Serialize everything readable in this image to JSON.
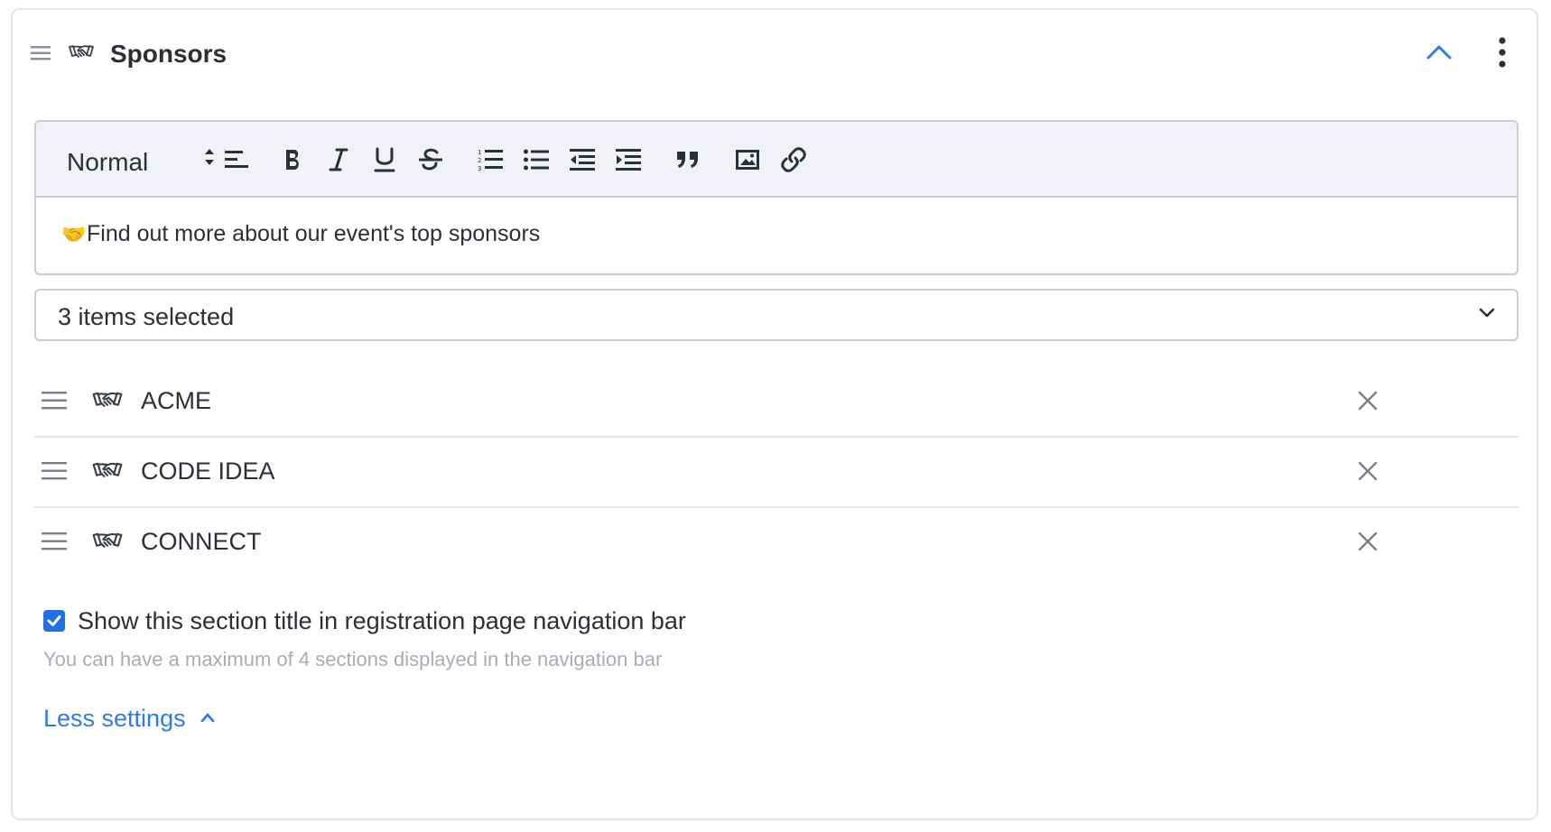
{
  "section": {
    "title": "Sponsors",
    "icon": "handshake-icon",
    "collapse_icon": "chevron-up-icon",
    "more_icon": "more-vertical-icon"
  },
  "editor": {
    "format_select": "Normal",
    "toolbar_icons": [
      "align-left-icon",
      "bold-icon",
      "italic-icon",
      "underline-icon",
      "strikethrough-icon",
      "ordered-list-icon",
      "bullet-list-icon",
      "outdent-icon",
      "indent-icon",
      "quote-icon",
      "image-icon",
      "link-icon"
    ],
    "content_emoji": "🤝",
    "content_text": "Find out more about our event's top sponsors"
  },
  "sponsor_select": {
    "label": "3 items selected"
  },
  "sponsors": [
    {
      "name": "ACME"
    },
    {
      "name": "CODE IDEA"
    },
    {
      "name": "CONNECT"
    }
  ],
  "nav_option": {
    "checked": true,
    "label": "Show this section title in registration page navigation bar",
    "helper": "You can have a maximum of 4 sections displayed in the navigation bar"
  },
  "settings_toggle": {
    "label": "Less settings"
  },
  "colors": {
    "accent": "#2d7be5",
    "checkbox": "#1f6fe5",
    "border": "#c9ced5",
    "toolbar_bg": "#f0f2f5",
    "muted_text": "#a7adb6"
  }
}
